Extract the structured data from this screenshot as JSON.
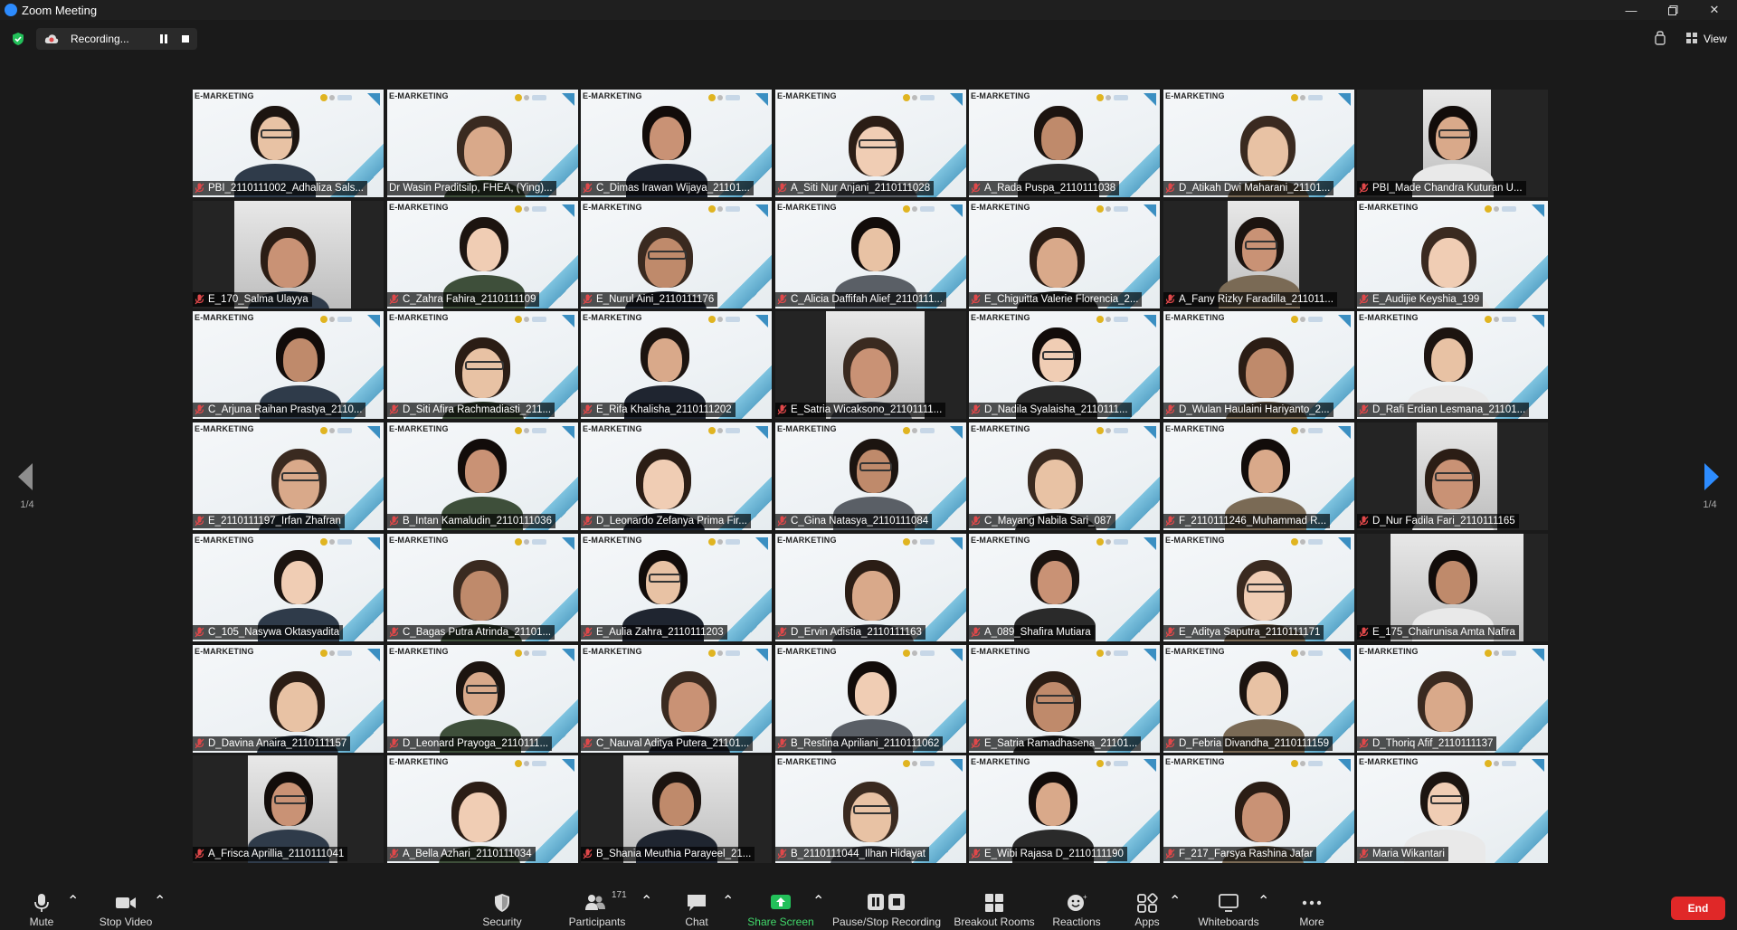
{
  "window": {
    "title": "Zoom Meeting",
    "controls": [
      "minimize-icon",
      "maximize-icon",
      "close-icon"
    ]
  },
  "recording": {
    "label": "Recording...",
    "status_icon": "cloud-record-icon"
  },
  "view": {
    "label": "View"
  },
  "pagination": {
    "left": "1/4",
    "right": "1/4"
  },
  "grid": {
    "columns": 7,
    "tiles": [
      {
        "name": "PBI_2110111002_Adhaliza Sals...",
        "muted": true,
        "bg": "slide"
      },
      {
        "name": "Dr Wasin Praditsilp, FHEA, (Ying)...",
        "muted": false,
        "bg": "slide",
        "active": true
      },
      {
        "name": "C_Dimas Irawan Wijaya_21101...",
        "muted": true,
        "bg": "slide"
      },
      {
        "name": "A_Siti Nur Anjani_2110111028",
        "muted": true,
        "bg": "slide"
      },
      {
        "name": "A_Rada Puspa_2110111038",
        "muted": true,
        "bg": "slide"
      },
      {
        "name": "D_Atikah Dwi Maharani_21101...",
        "muted": true,
        "bg": "slide"
      },
      {
        "name": "PBI_Made Chandra Kuturan U...",
        "muted": true,
        "bg": "cam"
      },
      {
        "name": "E_170_Salma Ulayya",
        "muted": true,
        "bg": "cam"
      },
      {
        "name": "C_Zahra Fahira_2110111109",
        "muted": true,
        "bg": "slide"
      },
      {
        "name": "E_Nurul Aini_2110111176",
        "muted": true,
        "bg": "slide"
      },
      {
        "name": "C_Alicia Daffifah Alief_2110111...",
        "muted": true,
        "bg": "slide"
      },
      {
        "name": "E_Chiguitta Valerie Florencia_2...",
        "muted": true,
        "bg": "slide"
      },
      {
        "name": "A_Fany Rizky Faradilla_211011...",
        "muted": true,
        "bg": "cam"
      },
      {
        "name": "E_Audijie Keyshia_199",
        "muted": true,
        "bg": "slide"
      },
      {
        "name": "C_Arjuna Raihan Prastya_2110...",
        "muted": true,
        "bg": "slide"
      },
      {
        "name": "D_Siti Afira Rachmadiasti_211...",
        "muted": true,
        "bg": "slide"
      },
      {
        "name": "E_Rifa Khalisha_2110111202",
        "muted": true,
        "bg": "slide"
      },
      {
        "name": "E_Satria Wicaksono_21101111...",
        "muted": true,
        "bg": "cam"
      },
      {
        "name": "D_Nadila Syalaisha_2110111...",
        "muted": true,
        "bg": "slide"
      },
      {
        "name": "D_Wulan Haulaini Hariyanto_2...",
        "muted": true,
        "bg": "slide"
      },
      {
        "name": "D_Rafi Erdian Lesmana_21101...",
        "muted": true,
        "bg": "slide"
      },
      {
        "name": "E_2110111197_Irfan Zhafran",
        "muted": true,
        "bg": "slide"
      },
      {
        "name": "B_Intan Kamaludin_2110111036",
        "muted": true,
        "bg": "slide"
      },
      {
        "name": "D_Leonardo Zefanya Prima Fir...",
        "muted": true,
        "bg": "slide"
      },
      {
        "name": "C_Gina Natasya_2110111084",
        "muted": true,
        "bg": "slide"
      },
      {
        "name": "C_Mayang Nabila Sari_087",
        "muted": true,
        "bg": "slide"
      },
      {
        "name": "F_2110111246_Muhammad R...",
        "muted": true,
        "bg": "slide"
      },
      {
        "name": "D_Nur Fadila Fari_2110111165",
        "muted": true,
        "bg": "cam"
      },
      {
        "name": "C_105_Nasywa Oktasyadita",
        "muted": true,
        "bg": "slide"
      },
      {
        "name": "C_Bagas Putra Atrinda_21101...",
        "muted": true,
        "bg": "slide"
      },
      {
        "name": "E_Aulia Zahra_2110111203",
        "muted": true,
        "bg": "slide"
      },
      {
        "name": "D_Ervin Adistia_2110111163",
        "muted": true,
        "bg": "slide"
      },
      {
        "name": "A_089_Shafira Mutiara",
        "muted": true,
        "bg": "slide"
      },
      {
        "name": "E_Aditya Saputra_2110111171",
        "muted": true,
        "bg": "slide"
      },
      {
        "name": "E_175_Chairunisa Amta Nafira",
        "muted": true,
        "bg": "cam"
      },
      {
        "name": "D_Davina Anaira_2110111157",
        "muted": true,
        "bg": "slide"
      },
      {
        "name": "D_Leonard Prayoga_2110111...",
        "muted": true,
        "bg": "slide"
      },
      {
        "name": "C_Nauval Aditya Putera_21101...",
        "muted": true,
        "bg": "slide"
      },
      {
        "name": "B_Restina Apriliani_2110111062",
        "muted": true,
        "bg": "slide"
      },
      {
        "name": "E_Satria Ramadhasena_21101...",
        "muted": true,
        "bg": "slide"
      },
      {
        "name": "D_Febria Divandha_2110111159",
        "muted": true,
        "bg": "slide"
      },
      {
        "name": "D_Thoriq Afif_2110111137",
        "muted": true,
        "bg": "slide"
      },
      {
        "name": "A_Frisca Aprillia_2110111041",
        "muted": true,
        "bg": "cam"
      },
      {
        "name": "A_Bella Azhari_2110111034",
        "muted": true,
        "bg": "slide"
      },
      {
        "name": "B_Shania Meuthia Parayeel_21...",
        "muted": true,
        "bg": "cam"
      },
      {
        "name": "B_2110111044_Ilhan Hidayat",
        "muted": true,
        "bg": "slide"
      },
      {
        "name": "E_Wibi Rajasa D_2110111190",
        "muted": true,
        "bg": "slide"
      },
      {
        "name": "F_217_Farsya Rashina Jafar",
        "muted": true,
        "bg": "slide"
      },
      {
        "name": "Maria Wikantari",
        "muted": true,
        "bg": "slide"
      }
    ]
  },
  "slide": {
    "brand": "E-MARKETING"
  },
  "toolbar": {
    "mute": "Mute",
    "stop_video": "Stop Video",
    "security": "Security",
    "participants": "Participants",
    "participants_count": "171",
    "chat": "Chat",
    "share_screen": "Share Screen",
    "pause_stop_recording": "Pause/Stop Recording",
    "breakout_rooms": "Breakout Rooms",
    "reactions": "Reactions",
    "apps": "Apps",
    "whiteboards": "Whiteboards",
    "more": "More",
    "end": "End"
  },
  "colors": {
    "active_speaker": "#c7e53a",
    "share_green": "#41d86a",
    "end_red": "#e02828",
    "muted_red": "#e0484a",
    "background": "#1a1a1a"
  }
}
